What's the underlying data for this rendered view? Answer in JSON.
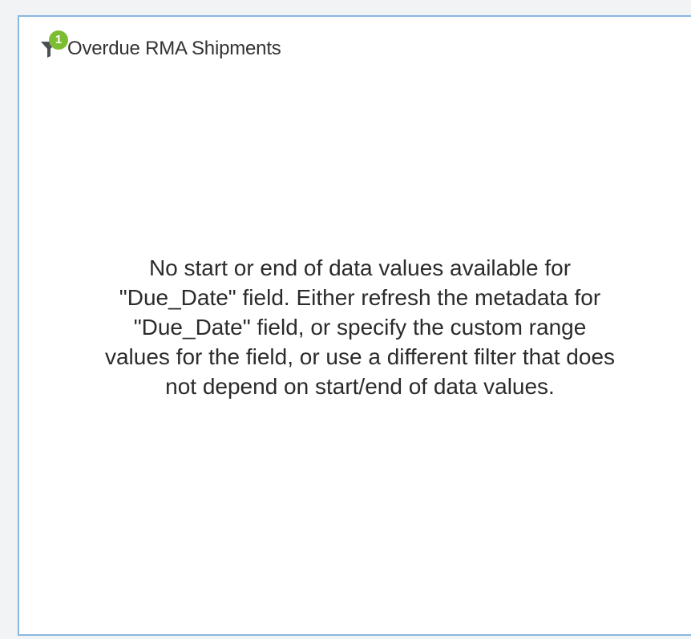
{
  "widget": {
    "title": "Overdue RMA Shipments",
    "filter_count": "1",
    "message": "No start or end of data values available for\n\"Due_Date\" field. Either refresh the metadata for\n\"Due_Date\" field, or specify the custom range\nvalues for the field, or use a different filter that does\nnot depend on start/end of data values."
  },
  "icons": {
    "filter": "filter-funnel-icon"
  },
  "colors": {
    "panel_border": "#8ab8e0",
    "badge_bg": "#7cbd32",
    "background": "#f2f3f5",
    "text": "#2b2b2b"
  }
}
